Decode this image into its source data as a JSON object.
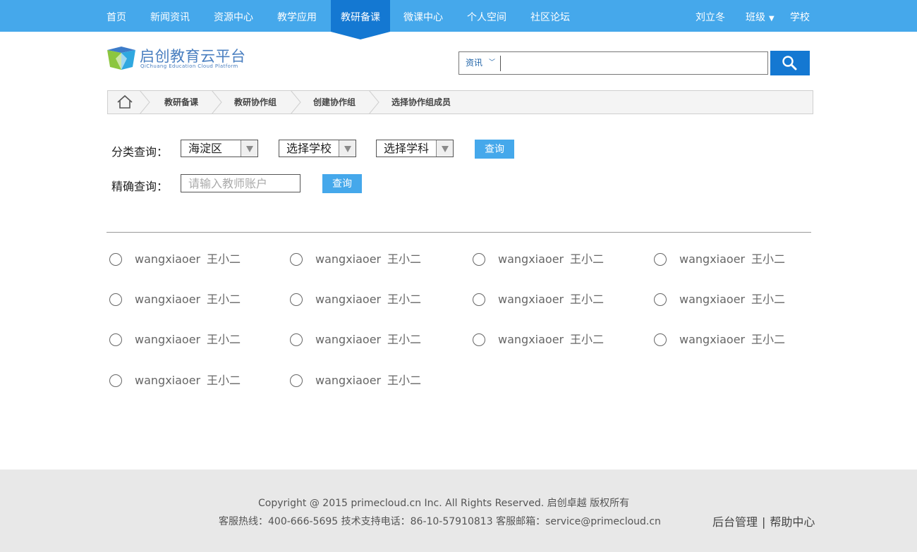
{
  "nav": {
    "items": [
      "首页",
      "新闻资讯",
      "资源中心",
      "教学应用",
      "教研备课",
      "微课中心",
      "个人空间",
      "社区论坛"
    ],
    "active_index": 4,
    "user_name": "刘立冬",
    "class_label": "班级",
    "school_label": "学校"
  },
  "logo": {
    "title": "启创教育云平台",
    "subtitle": "QiChuang Education Cloud Platform"
  },
  "search": {
    "category": "资讯",
    "value": "",
    "placeholder": ""
  },
  "breadcrumb": [
    "教研备课",
    "教研协作组",
    "创建协作组",
    "选择协作组成员"
  ],
  "filter": {
    "category_label": "分类查询：",
    "district": "海淀区",
    "school": "选择学校",
    "subject": "选择学科",
    "query_button": "查询",
    "exact_label": "精确查询：",
    "account_placeholder": "请输入教师账户",
    "exact_button": "查询"
  },
  "teachers": [
    {
      "account": "wangxiaoer",
      "name": "王小二"
    },
    {
      "account": "wangxiaoer",
      "name": "王小二"
    },
    {
      "account": "wangxiaoer",
      "name": "王小二"
    },
    {
      "account": "wangxiaoer",
      "name": "王小二"
    },
    {
      "account": "wangxiaoer",
      "name": "王小二"
    },
    {
      "account": "wangxiaoer",
      "name": "王小二"
    },
    {
      "account": "wangxiaoer",
      "name": "王小二"
    },
    {
      "account": "wangxiaoer",
      "name": "王小二"
    },
    {
      "account": "wangxiaoer",
      "name": "王小二"
    },
    {
      "account": "wangxiaoer",
      "name": "王小二"
    },
    {
      "account": "wangxiaoer",
      "name": "王小二"
    },
    {
      "account": "wangxiaoer",
      "name": "王小二"
    },
    {
      "account": "wangxiaoer",
      "name": "王小二"
    },
    {
      "account": "wangxiaoer",
      "name": "王小二"
    }
  ],
  "footer": {
    "copyright": "Copyright @ 2015 primecloud.cn  Inc. All Rights Reserved.   启创卓越   版权所有",
    "contact": "客服热线：400-666-5695  技术支持电话：86-10-57910813  客服邮箱：service@primecloud.cn",
    "admin_link": "后台管理",
    "help_link": "帮助中心"
  },
  "colors": {
    "nav_bg": "#45a8eb",
    "nav_active": "#1478d2",
    "button": "#45a8eb",
    "footer_bg": "#e8e8e8"
  }
}
